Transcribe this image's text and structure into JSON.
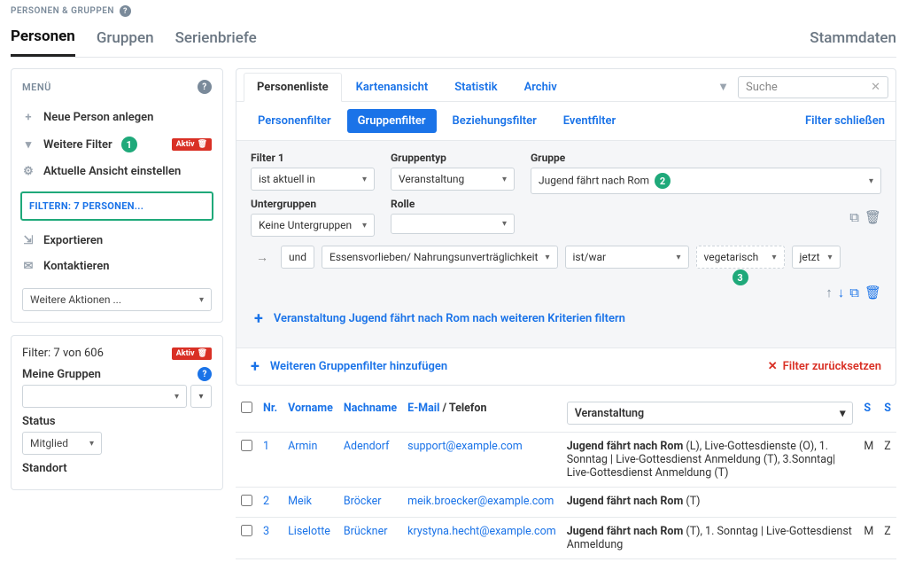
{
  "breadcrumb": "PERSONEN & GRUPPEN",
  "tabs": {
    "personen": "Personen",
    "gruppen": "Gruppen",
    "serienbriefe": "Serienbriefe",
    "stammdaten": "Stammdaten"
  },
  "sidebar": {
    "menu_title": "MENÜ",
    "neue_person": "Neue Person anlegen",
    "weitere_filter": "Weitere Filter",
    "aktiv_badge": "Aktiv",
    "ansicht": "Aktuelle Ansicht einstellen",
    "filtern_label": "FILTERN: 7 PERSONEN...",
    "exportieren": "Exportieren",
    "kontaktieren": "Kontaktieren",
    "weitere_aktionen": "Weitere Aktionen ...",
    "filter_count": "Filter: 7 von 606",
    "meine_gruppen": "Meine Gruppen",
    "status_label": "Status",
    "status_value": "Mitglied",
    "standort_label": "Standort"
  },
  "list_tabs": {
    "personenliste": "Personenliste",
    "kartenansicht": "Kartenansicht",
    "statistik": "Statistik",
    "archiv": "Archiv"
  },
  "search_placeholder": "Suche",
  "filter_tabs": {
    "personenfilter": "Personenfilter",
    "gruppenfilter": "Gruppenfilter",
    "beziehungsfilter": "Beziehungsfilter",
    "eventfilter": "Eventfilter",
    "close": "Filter schließen"
  },
  "filter": {
    "filter1_label": "Filter 1",
    "filter1_value": "ist aktuell in",
    "gruppentyp_label": "Gruppentyp",
    "gruppentyp_value": "Veranstaltung",
    "gruppe_label": "Gruppe",
    "gruppe_value": "Jugend fährt nach Rom",
    "untergruppen_label": "Untergruppen",
    "untergruppen_value": "Keine Untergruppen",
    "rolle_label": "Rolle",
    "and": "und",
    "field_value": "Essensvorlieben/ Nahrungsunverträglichkeit",
    "op_value": "ist/war",
    "val_value": "vegetarisch",
    "time_value": "jetzt",
    "more_criteria": "Veranstaltung Jugend fährt nach Rom nach weiteren Kriterien filtern",
    "add_filter": "Weiteren Gruppenfilter hinzufügen",
    "reset": "Filter zurücksetzen"
  },
  "table": {
    "nr": "Nr.",
    "vorname": "Vorname",
    "nachname": "Nachname",
    "email": "E-Mail",
    "telefon": "Telefon",
    "emailtel_sep": " / ",
    "event_header": "Veranstaltung",
    "s1": "S",
    "s2": "S",
    "rows": [
      {
        "nr": "1",
        "vorname": "Armin",
        "nachname": "Adendorf",
        "email": "support@example.com",
        "event": "Jugend fährt nach Rom (L), Live-Gottesdienste (O), 1. Sonntag | Live-Gottesdienst Anmeldung (T), 3.Sonntag| Live-Gottesdienst Anmeldung (T)",
        "c1": "M",
        "c2": "Z"
      },
      {
        "nr": "2",
        "vorname": "Meik",
        "nachname": "Bröcker",
        "email": "meik.broecker@example.com",
        "event": "Jugend fährt nach Rom (T)",
        "c1": "",
        "c2": ""
      },
      {
        "nr": "3",
        "vorname": "Liselotte",
        "nachname": "Brückner",
        "email": "krystyna.hecht@example.com",
        "event": "Jugend fährt nach Rom (T), 1. Sonntag | Live-Gottesdienst Anmeldung",
        "c1": "M",
        "c2": "Z"
      }
    ]
  },
  "badges": {
    "b1": "1",
    "b2": "2",
    "b3": "3"
  }
}
